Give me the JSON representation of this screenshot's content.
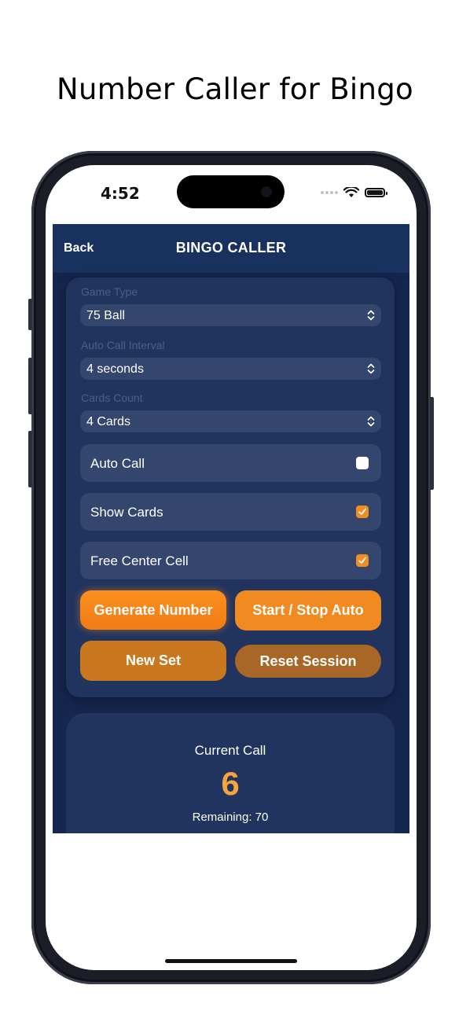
{
  "headline": "Number Caller for Bingo",
  "status_bar": {
    "time": "4:52"
  },
  "navbar": {
    "back_label": "Back",
    "title": "BINGO CALLER"
  },
  "settings": {
    "game_type": {
      "label": "Game Type",
      "value": "75 Ball"
    },
    "auto_call_interval": {
      "label": "Auto Call Interval",
      "value": "4 seconds"
    },
    "cards_count": {
      "label": "Cards Count",
      "value": "4 Cards"
    },
    "toggles": [
      {
        "label": "Auto Call",
        "checked": false
      },
      {
        "label": "Show Cards",
        "checked": true
      },
      {
        "label": "Free Center Cell",
        "checked": true
      }
    ]
  },
  "actions": {
    "generate": "Generate Number",
    "start_stop": "Start / Stop Auto",
    "new_set": "New Set",
    "reset": "Reset Session"
  },
  "current_call": {
    "label": "Current Call",
    "number": "6",
    "remaining": "Remaining: 70"
  },
  "colors": {
    "accent": "#f08e22",
    "navbar": "#19315f",
    "background": "#14254c",
    "number": "#f5a53a"
  }
}
